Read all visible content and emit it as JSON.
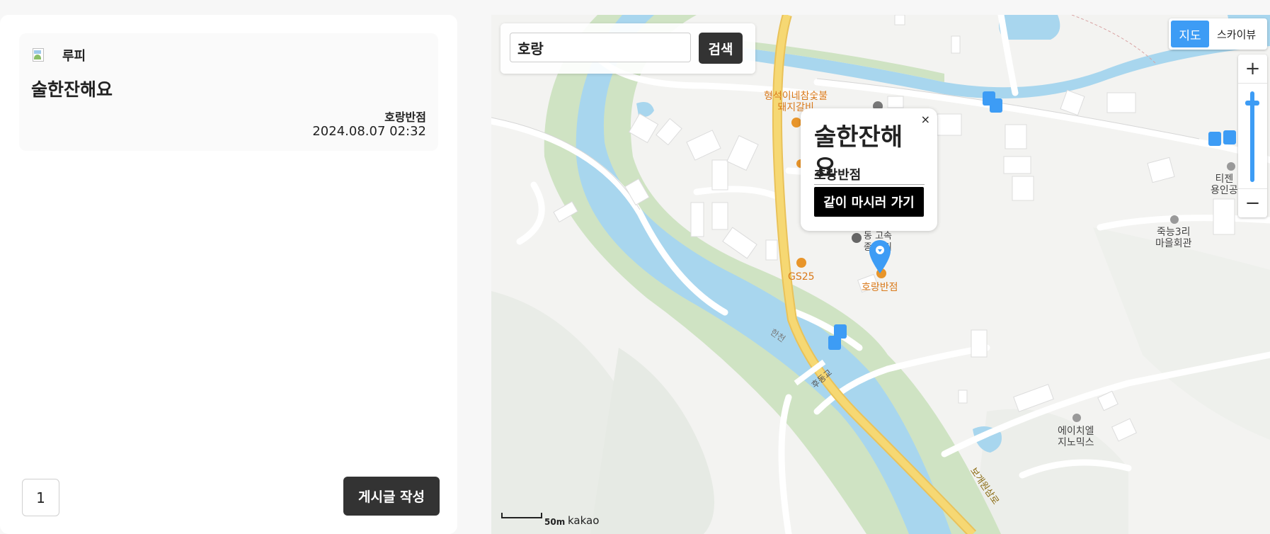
{
  "post": {
    "author": "루피",
    "title": "술한잔해요",
    "store": "호랑반점",
    "date": "2024.08.07 02:32"
  },
  "pagination": {
    "current": "1"
  },
  "write_button": "게시글 작성",
  "search": {
    "value": "호랑",
    "button": "검색"
  },
  "map_type": {
    "map": "지도",
    "skyview": "스카이뷰"
  },
  "zoom": {
    "in": "+",
    "out": "−",
    "level": 0.88
  },
  "info_window": {
    "title": "술한잔해요",
    "store": "호랑반점",
    "button": "같이 마시러 가기",
    "close": "×"
  },
  "map_labels": {
    "poi_1_line1": "형석이네참숯불",
    "poi_1_line2": "돼지갈비",
    "gs25": "GS25",
    "horang": "호랑반점",
    "poi_center_line1": "동  고속",
    "poi_center_line2": "종  정비",
    "jukneung_line1": "죽능3리",
    "jukneung_line2": "마을회관",
    "ticket_line1": "티젠",
    "ticket_line2": "용인공",
    "hchl_line1": "에이치엘",
    "hchl_line2": "지노믹스",
    "river": "한천",
    "bridge": "후동교",
    "road": "보개원삼로"
  },
  "scale": "50m",
  "copyright": "kakao",
  "colors": {
    "accent": "#3d9cf5",
    "dark_button": "#333333",
    "river": "#a8d6ee",
    "riverbank": "#cfe3c3",
    "main_road": "#f6d873",
    "poi_orange": "#d9791a"
  }
}
